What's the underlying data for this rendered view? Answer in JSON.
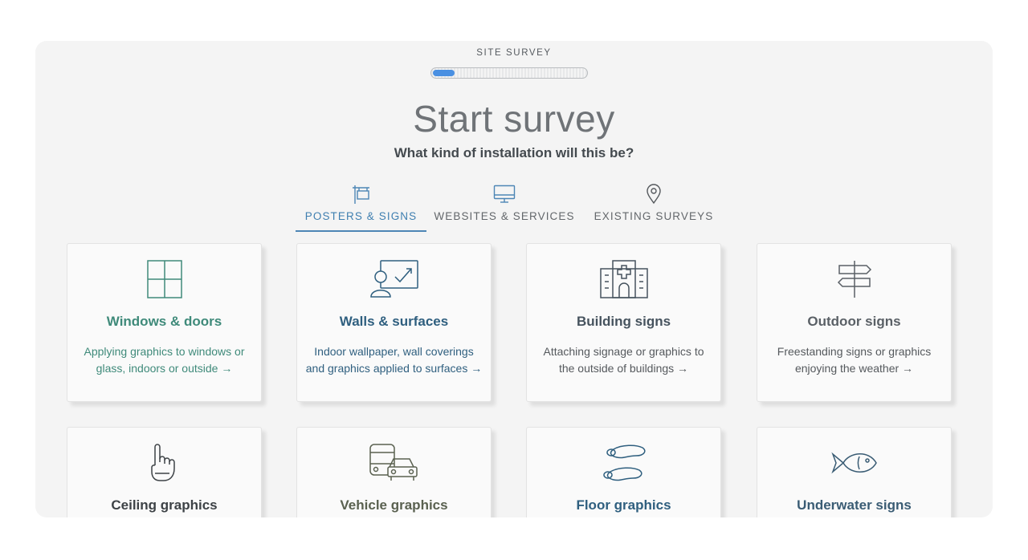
{
  "header": {
    "label": "SITE SURVEY",
    "progress": 0.14,
    "title": "Start survey",
    "subtitle": "What kind of installation will this be?"
  },
  "tabs": [
    {
      "label": "POSTERS & SIGNS",
      "icon": "poster-sign-icon",
      "active": true
    },
    {
      "label": "WEBSITES & SERVICES",
      "icon": "monitor-icon",
      "active": false
    },
    {
      "label": "EXISTING SURVEYS",
      "icon": "location-pin-icon",
      "active": false
    }
  ],
  "cards": [
    {
      "title": "Windows & doors",
      "desc": "Applying graphics to windows or glass, indoors or outside",
      "arrow": "→",
      "icon": "window-icon",
      "color": "#3f8a7a"
    },
    {
      "title": "Walls & surfaces",
      "desc": "Indoor wallpaper, wall coverings and graphics applied to surfaces",
      "arrow": "→",
      "icon": "presenter-board-icon",
      "color": "#2f5f7f"
    },
    {
      "title": "Building signs",
      "desc": "Attaching signage or graphics to the outside of buildings",
      "arrow": "→",
      "icon": "hospital-building-icon",
      "color": "#46535e"
    },
    {
      "title": "Outdoor signs",
      "desc": "Freestanding signs or graphics enjoying the weather",
      "arrow": "→",
      "icon": "signpost-icon",
      "color": "#5a6066"
    },
    {
      "title": "Ceiling graphics",
      "icon": "pointing-hand-icon",
      "color": "#3d4246"
    },
    {
      "title": "Vehicle graphics",
      "icon": "vehicles-icon",
      "color": "#5a6150"
    },
    {
      "title": "Floor graphics",
      "icon": "footprints-icon",
      "color": "#2f5f7f"
    },
    {
      "title": "Underwater signs",
      "icon": "fish-icon",
      "color": "#3a5c74"
    }
  ],
  "colors": {
    "accent": "#4d86b5",
    "panel_bg": "#f4f4f4",
    "card_bg": "#fafafa",
    "progress_fill": "#4a90e2"
  }
}
